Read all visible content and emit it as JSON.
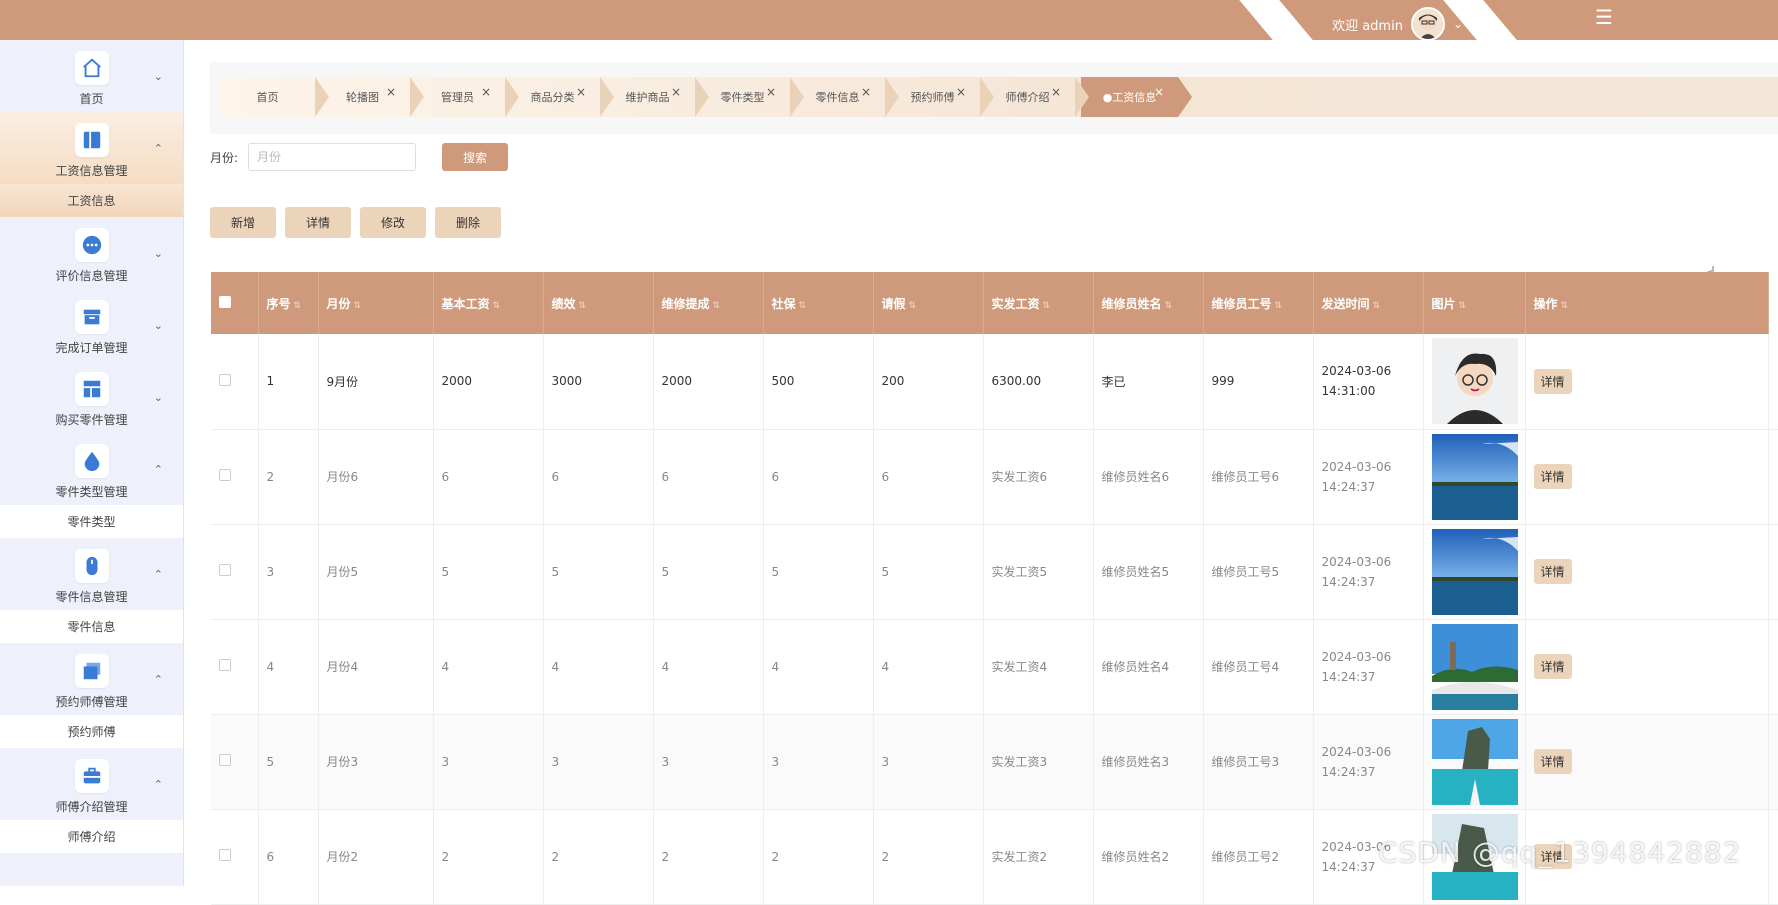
{
  "header": {
    "welcome": "欢迎 admin",
    "colors": {
      "brand": "#cf9a7b",
      "accent_light": "#ecd4ba"
    }
  },
  "sidebar": {
    "groups": [
      {
        "label": "首页",
        "icon": "home-icon",
        "expanded": false,
        "children": []
      },
      {
        "label": "工资信息管理",
        "icon": "book-icon",
        "expanded": true,
        "children": [
          "工资信息"
        ]
      },
      {
        "label": "评价信息管理",
        "icon": "comment-icon",
        "expanded": false,
        "children": []
      },
      {
        "label": "完成订单管理",
        "icon": "archive-icon",
        "expanded": false,
        "children": []
      },
      {
        "label": "购买零件管理",
        "icon": "layout-icon",
        "expanded": false,
        "children": []
      },
      {
        "label": "零件类型管理",
        "icon": "drop-icon",
        "expanded": true,
        "children": [
          "零件类型"
        ]
      },
      {
        "label": "零件信息管理",
        "icon": "mouse-icon",
        "expanded": true,
        "children": [
          "零件信息"
        ]
      },
      {
        "label": "预约师傅管理",
        "icon": "folder-icon",
        "expanded": true,
        "children": [
          "预约师傅"
        ]
      },
      {
        "label": "师傅介绍管理",
        "icon": "briefcase-icon",
        "expanded": true,
        "children": [
          "师傅介绍"
        ]
      }
    ]
  },
  "tabs": [
    "首页",
    "轮播图",
    "管理员",
    "商品分类",
    "维护商品",
    "零件类型",
    "零件信息",
    "预约师傅",
    "师傅介绍",
    "●工资信息"
  ],
  "search": {
    "label": "月份:",
    "placeholder": "月份",
    "button": "搜索"
  },
  "actions": {
    "add": "新增",
    "detail": "详情",
    "edit": "修改",
    "delete": "删除"
  },
  "table": {
    "columns": [
      "序号",
      "月份",
      "基本工资",
      "绩效",
      "维修提成",
      "社保",
      "请假",
      "实发工资",
      "维修员姓名",
      "维修员工号",
      "发送时间",
      "图片",
      "操作"
    ],
    "rows": [
      {
        "no": "1",
        "month": "9月份",
        "base": "2000",
        "perf": "3000",
        "commission": "2000",
        "insurance": "500",
        "leave": "200",
        "net": "6300.00",
        "name": "李已",
        "staff_no": "999",
        "time": "2024-03-06 14:31:00",
        "image": "cartoon-avatar",
        "op": "详情"
      },
      {
        "no": "2",
        "month": "月份6",
        "base": "6",
        "perf": "6",
        "commission": "6",
        "insurance": "6",
        "leave": "6",
        "net": "实发工资6",
        "name": "维修员姓名6",
        "staff_no": "维修员工号6",
        "time": "2024-03-06 14:24:37",
        "image": "lake-sky",
        "op": "详情"
      },
      {
        "no": "3",
        "month": "月份5",
        "base": "5",
        "perf": "5",
        "commission": "5",
        "insurance": "5",
        "leave": "5",
        "net": "实发工资5",
        "name": "维修员姓名5",
        "staff_no": "维修员工号5",
        "time": "2024-03-06 14:24:37",
        "image": "lake-sky",
        "op": "详情"
      },
      {
        "no": "4",
        "month": "月份4",
        "base": "4",
        "perf": "4",
        "commission": "4",
        "insurance": "4",
        "leave": "4",
        "net": "实发工资4",
        "name": "维修员姓名4",
        "staff_no": "维修员工号4",
        "time": "2024-03-06 14:24:37",
        "image": "bridge-pagoda",
        "op": "详情"
      },
      {
        "no": "5",
        "month": "月份3",
        "base": "3",
        "perf": "3",
        "commission": "3",
        "insurance": "3",
        "leave": "3",
        "net": "实发工资3",
        "name": "维修员姓名3",
        "staff_no": "维修员工号3",
        "time": "2024-03-06 14:24:37",
        "image": "cliffs-boat",
        "op": "详情"
      },
      {
        "no": "6",
        "month": "月份2",
        "base": "2",
        "perf": "2",
        "commission": "2",
        "insurance": "2",
        "leave": "2",
        "net": "实发工资2",
        "name": "维修员姓名2",
        "staff_no": "维修员工号2",
        "time": "2024-03-06 14:24:37",
        "image": "cliffs-boat",
        "op": "详情"
      }
    ]
  },
  "watermark": "CSDN @qq_1394842882"
}
